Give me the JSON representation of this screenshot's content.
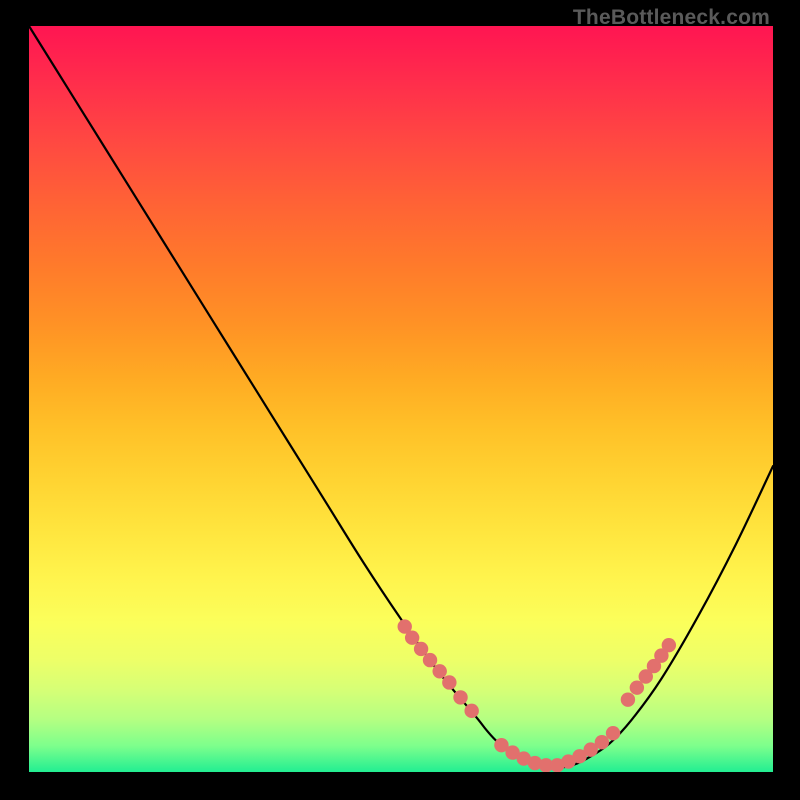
{
  "watermark": "TheBottleneck.com",
  "chart_data": {
    "type": "line",
    "title": "",
    "xlabel": "",
    "ylabel": "",
    "xlim": [
      0,
      100
    ],
    "ylim": [
      0,
      100
    ],
    "series": [
      {
        "name": "bottleneck-curve",
        "x": [
          0,
          5,
          10,
          15,
          20,
          25,
          30,
          35,
          40,
          45,
          50,
          55,
          60,
          61.5,
          63,
          65,
          67,
          69,
          71,
          73,
          75,
          78,
          81,
          85,
          90,
          95,
          100
        ],
        "y": [
          100,
          92,
          84,
          76,
          68,
          60,
          52,
          44,
          36,
          28,
          20.5,
          13.5,
          7.5,
          5.6,
          4,
          2.5,
          1.5,
          0.9,
          0.6,
          0.9,
          1.8,
          3.8,
          7,
          12.5,
          21,
          30.5,
          41
        ],
        "stroke": "#000000"
      },
      {
        "name": "highlight-dots-left",
        "type": "scatter",
        "x": [
          50.5,
          51.5,
          52.7,
          53.9,
          55.2,
          56.5,
          58,
          59.5
        ],
        "y": [
          19.5,
          18,
          16.5,
          15,
          13.5,
          12,
          10,
          8.2
        ],
        "marker_color": "#E2706D"
      },
      {
        "name": "highlight-dots-bottom",
        "type": "scatter",
        "x": [
          63.5,
          65,
          66.5,
          68,
          69.5,
          71,
          72.5,
          74,
          75.5,
          77,
          78.5
        ],
        "y": [
          3.6,
          2.6,
          1.8,
          1.2,
          0.9,
          0.9,
          1.4,
          2.1,
          3.0,
          4.0,
          5.2
        ],
        "marker_color": "#E2706D"
      },
      {
        "name": "highlight-dots-right",
        "type": "scatter",
        "x": [
          80.5,
          81.7,
          82.9,
          84,
          85,
          86
        ],
        "y": [
          9.7,
          11.3,
          12.8,
          14.2,
          15.6,
          17
        ],
        "marker_color": "#E2706D"
      }
    ]
  }
}
